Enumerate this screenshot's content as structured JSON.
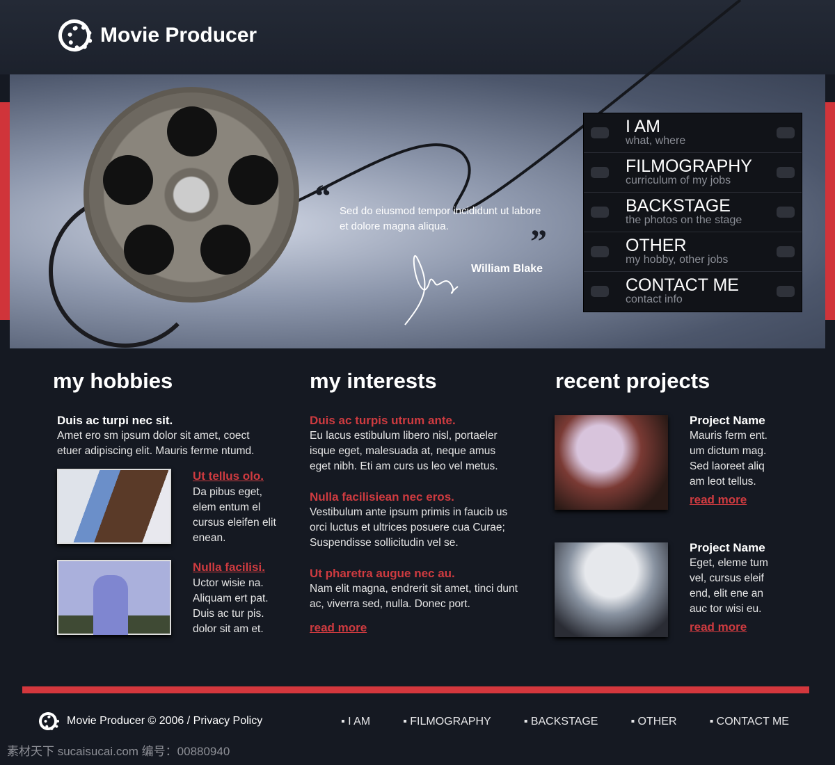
{
  "header": {
    "title": "Movie Producer",
    "logo_icon": "film-reel-icon"
  },
  "hero": {
    "quote": "Sed do eiusmod tempor incididunt ut labore et dolore magna aliqua.",
    "open_quote": "“",
    "close_quote": "”",
    "author": "William Blake"
  },
  "menu": [
    {
      "label": "I AM",
      "sub": "what, where"
    },
    {
      "label": "FILMOGRAPHY",
      "sub": "curriculum of my jobs"
    },
    {
      "label": "BACKSTAGE",
      "sub": "the photos on the stage"
    },
    {
      "label": "OTHER",
      "sub": "my hobby, other jobs"
    },
    {
      "label": "CONTACT ME",
      "sub": "contact info"
    }
  ],
  "hobbies": {
    "title": "my hobbies",
    "intro_title": "Duis ac turpi nec sit.",
    "intro_text": "Amet ero sm ipsum  dolor sit amet, coect etuer adipiscing elit. Mauris ferme ntumd.",
    "items": [
      {
        "title": "Ut tellus olo.",
        "text": "Da pibus eget, elem entum el cursus eleifen elit enean."
      },
      {
        "title": "Nulla facilisi.",
        "text": "Uctor wisie na. Aliquam ert pat. Duis ac tur pis. dolor sit am et."
      }
    ]
  },
  "interests": {
    "title": "my interests",
    "items": [
      {
        "title": "Duis ac turpis utrum ante.",
        "text": "Eu lacus estibulum libero nisl, portaeler isque eget, malesuada at, neque amus eget nibh. Eti am curs us leo vel metus."
      },
      {
        "title": "Nulla facilisiean nec eros.",
        "text": "Vestibulum ante ipsum primis in faucib us orci luctus et ultrices posuere cua Curae; Suspendisse sollicitudin vel se."
      },
      {
        "title": "Ut pharetra augue nec au.",
        "text": "Nam elit magna, endrerit sit amet, tinci dunt ac, viverra sed, nulla. Donec port."
      }
    ],
    "read_more": "read more"
  },
  "projects": {
    "title": "recent projects",
    "items": [
      {
        "name": "Project Name",
        "text": "Mauris ferm ent. um dictum  mag. Sed laoreet aliq am leot tellus.",
        "read_more": "read more"
      },
      {
        "name": "Project Name",
        "text": "Eget, eleme tum vel, cursus eleif end, elit ene an auc tor wisi eu.",
        "read_more": "read more"
      }
    ]
  },
  "footer": {
    "copyright": "Movie Producer © 2006 / Privacy Policy",
    "nav": [
      "▪ I AM",
      "▪ FILMOGRAPHY",
      "▪ BACKSTAGE",
      "▪ OTHER",
      "▪ CONTACT ME"
    ]
  },
  "watermark": "素材天下 sucaisucai.com  编号：00880940",
  "colors": {
    "accent": "#d0343a",
    "background": "#151922"
  }
}
